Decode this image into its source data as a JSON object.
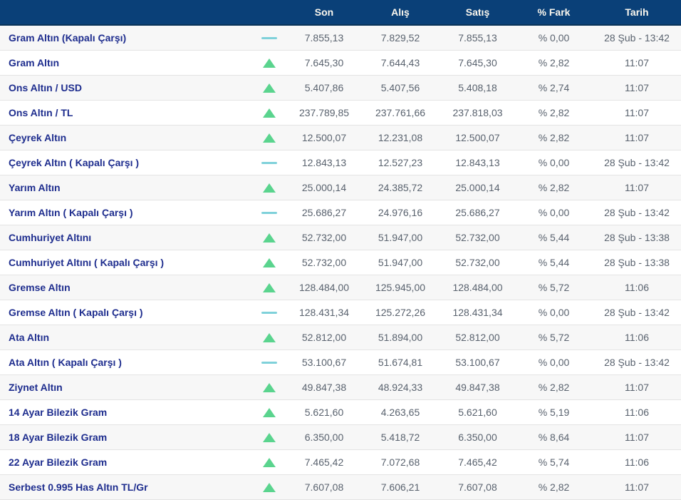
{
  "colors": {
    "header_bg": "#0a4078",
    "header_text": "#fbf7ee",
    "instrument_name": "#1e2d8e",
    "value_text": "#59626e",
    "trend_up": "#5ad48e",
    "trend_flat": "#7fd1da",
    "row_alt_bg": "#f7f7f7",
    "row_border": "#e4e4e4"
  },
  "table": {
    "header": {
      "name": "",
      "trend": "",
      "son": "Son",
      "alis": "Alış",
      "satis": "Satış",
      "fark": "% Fark",
      "tarih": "Tarih"
    },
    "rows": [
      {
        "name": "Gram Altın (Kapalı Çarşı)",
        "trend": "flat",
        "son": "7.855,13",
        "alis": "7.829,52",
        "satis": "7.855,13",
        "fark": "% 0,00",
        "tarih": "28 Şub - 13:42"
      },
      {
        "name": "Gram Altın",
        "trend": "up",
        "son": "7.645,30",
        "alis": "7.644,43",
        "satis": "7.645,30",
        "fark": "% 2,82",
        "tarih": "11:07"
      },
      {
        "name": "Ons Altın / USD",
        "trend": "up",
        "son": "5.407,86",
        "alis": "5.407,56",
        "satis": "5.408,18",
        "fark": "% 2,74",
        "tarih": "11:07"
      },
      {
        "name": "Ons Altın / TL",
        "trend": "up",
        "son": "237.789,85",
        "alis": "237.761,66",
        "satis": "237.818,03",
        "fark": "% 2,82",
        "tarih": "11:07"
      },
      {
        "name": "Çeyrek Altın",
        "trend": "up",
        "son": "12.500,07",
        "alis": "12.231,08",
        "satis": "12.500,07",
        "fark": "% 2,82",
        "tarih": "11:07"
      },
      {
        "name": "Çeyrek Altın ( Kapalı Çarşı )",
        "trend": "flat",
        "son": "12.843,13",
        "alis": "12.527,23",
        "satis": "12.843,13",
        "fark": "% 0,00",
        "tarih": "28 Şub - 13:42"
      },
      {
        "name": "Yarım Altın",
        "trend": "up",
        "son": "25.000,14",
        "alis": "24.385,72",
        "satis": "25.000,14",
        "fark": "% 2,82",
        "tarih": "11:07"
      },
      {
        "name": "Yarım Altın ( Kapalı Çarşı )",
        "trend": "flat",
        "son": "25.686,27",
        "alis": "24.976,16",
        "satis": "25.686,27",
        "fark": "% 0,00",
        "tarih": "28 Şub - 13:42"
      },
      {
        "name": "Cumhuriyet Altını",
        "trend": "up",
        "son": "52.732,00",
        "alis": "51.947,00",
        "satis": "52.732,00",
        "fark": "% 5,44",
        "tarih": "28 Şub - 13:38"
      },
      {
        "name": "Cumhuriyet Altını ( Kapalı Çarşı )",
        "trend": "up",
        "son": "52.732,00",
        "alis": "51.947,00",
        "satis": "52.732,00",
        "fark": "% 5,44",
        "tarih": "28 Şub - 13:38"
      },
      {
        "name": "Gremse Altın",
        "trend": "up",
        "son": "128.484,00",
        "alis": "125.945,00",
        "satis": "128.484,00",
        "fark": "% 5,72",
        "tarih": "11:06"
      },
      {
        "name": "Gremse Altın ( Kapalı Çarşı )",
        "trend": "flat",
        "son": "128.431,34",
        "alis": "125.272,26",
        "satis": "128.431,34",
        "fark": "% 0,00",
        "tarih": "28 Şub - 13:42"
      },
      {
        "name": "Ata Altın",
        "trend": "up",
        "son": "52.812,00",
        "alis": "51.894,00",
        "satis": "52.812,00",
        "fark": "% 5,72",
        "tarih": "11:06"
      },
      {
        "name": "Ata Altın ( Kapalı Çarşı )",
        "trend": "flat",
        "son": "53.100,67",
        "alis": "51.674,81",
        "satis": "53.100,67",
        "fark": "% 0,00",
        "tarih": "28 Şub - 13:42"
      },
      {
        "name": "Ziynet Altın",
        "trend": "up",
        "son": "49.847,38",
        "alis": "48.924,33",
        "satis": "49.847,38",
        "fark": "% 2,82",
        "tarih": "11:07"
      },
      {
        "name": "14 Ayar Bilezik Gram",
        "trend": "up",
        "son": "5.621,60",
        "alis": "4.263,65",
        "satis": "5.621,60",
        "fark": "% 5,19",
        "tarih": "11:06"
      },
      {
        "name": "18 Ayar Bilezik Gram",
        "trend": "up",
        "son": "6.350,00",
        "alis": "5.418,72",
        "satis": "6.350,00",
        "fark": "% 8,64",
        "tarih": "11:07"
      },
      {
        "name": "22 Ayar Bilezik Gram",
        "trend": "up",
        "son": "7.465,42",
        "alis": "7.072,68",
        "satis": "7.465,42",
        "fark": "% 5,74",
        "tarih": "11:06"
      },
      {
        "name": "Serbest 0.995 Has Altın TL/Gr",
        "trend": "up",
        "son": "7.607,08",
        "alis": "7.606,21",
        "satis": "7.607,08",
        "fark": "% 2,82",
        "tarih": "11:07"
      }
    ]
  }
}
